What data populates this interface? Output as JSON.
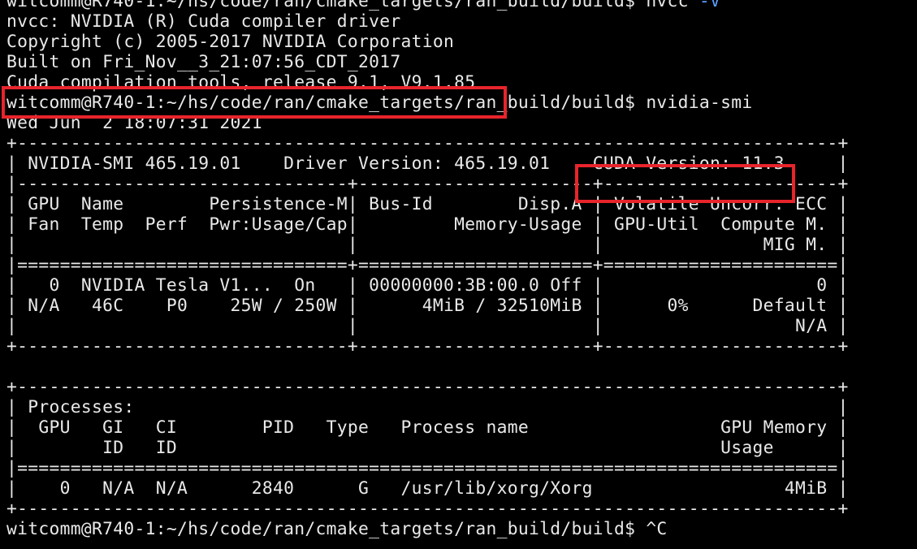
{
  "terminal": {
    "prompt_1": "witcomm@R740-1:~/hs/code/ran/cmake_targets/ran_build/build$ ",
    "command_1": "nvcc ",
    "command_1_arg": "-V",
    "nvcc_line_1": "nvcc: NVIDIA (R) Cuda compiler driver",
    "nvcc_line_2": "Copyright (c) 2005-2017 NVIDIA Corporation",
    "nvcc_line_3": "Built on Fri_Nov__3_21:07:56_CDT_2017",
    "nvcc_line_4": "Cuda compilation tools, release 9.1, V9.1.85",
    "prompt_2": "witcomm@R740-1:~/hs/code/ran/cmake_targets/ran_build/build$ ",
    "command_2": "nvidia-smi",
    "timestamp": "Wed Jun  2 18:07:31 2021",
    "smi_border_top": "+-----------------------------------------------------------------------------+",
    "smi_header_left": "| NVIDIA-SMI 465.19.01    Driver Version: 465.19.01    ",
    "smi_cuda_version": "CUDA Version: 11.3",
    "smi_header_right": "     |",
    "smi_sep_1": "|-------------------------------+----------------------+----------------------+",
    "smi_col_row_1": "| GPU  Name        Persistence-M| Bus-Id        Disp.A | Volatile Uncorr. ECC |",
    "smi_col_row_2": "| Fan  Temp  Perf  Pwr:Usage/Cap|         Memory-Usage | GPU-Util  Compute M. |",
    "smi_col_row_3": "|                               |                      |               MIG M. |",
    "smi_sep_2": "|===============================+======================+======================|",
    "smi_gpu_row_1": "|   0  NVIDIA Tesla V1...  On   | 00000000:3B:00.0 Off |                    0 |",
    "smi_gpu_row_2": "| N/A   46C    P0    25W / 250W |      4MiB / 32510MiB |      0%      Default |",
    "smi_gpu_row_3": "|                               |                      |                  N/A |",
    "smi_border_bottom_1": "+-------------------------------+----------------------+----------------------+",
    "blank": "",
    "proc_border_top": "+-----------------------------------------------------------------------------+",
    "proc_title": "| Processes:                                                                  |",
    "proc_cols_1": "|  GPU   GI   CI        PID   Type   Process name                  GPU Memory |",
    "proc_cols_2": "|        ID   ID                                                   Usage      |",
    "proc_sep": "|=============================================================================|",
    "proc_row_1": "|    0   N/A  N/A      2840      G   /usr/lib/xorg/Xorg                  4MiB |",
    "proc_border_bottom": "+-----------------------------------------------------------------------------+",
    "prompt_3": "witcomm@R740-1:~/hs/code/ran/cmake_targets/ran_build/build$ ",
    "command_3": "^C"
  },
  "colors": {
    "background": "#000000",
    "text": "#e9e9e9",
    "argument": "#5aa0ff",
    "highlight_box": "#e8242b"
  }
}
